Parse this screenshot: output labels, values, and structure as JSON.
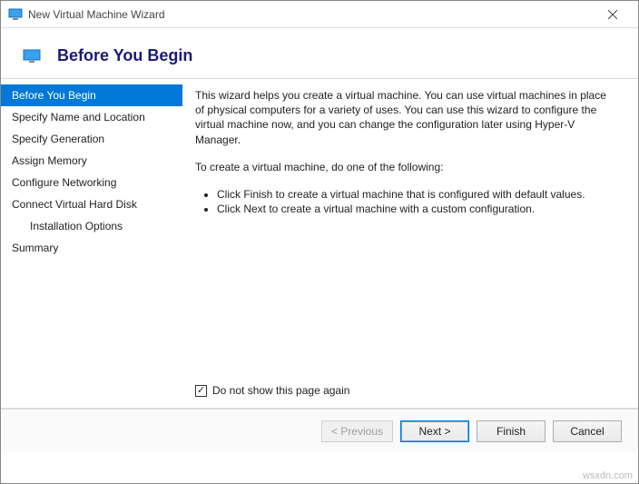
{
  "titlebar": {
    "title": "New Virtual Machine Wizard"
  },
  "header": {
    "title": "Before You Begin"
  },
  "sidebar": {
    "items": [
      {
        "label": "Before You Begin",
        "selected": true,
        "indent": false
      },
      {
        "label": "Specify Name and Location",
        "selected": false,
        "indent": false
      },
      {
        "label": "Specify Generation",
        "selected": false,
        "indent": false
      },
      {
        "label": "Assign Memory",
        "selected": false,
        "indent": false
      },
      {
        "label": "Configure Networking",
        "selected": false,
        "indent": false
      },
      {
        "label": "Connect Virtual Hard Disk",
        "selected": false,
        "indent": false
      },
      {
        "label": "Installation Options",
        "selected": false,
        "indent": true
      },
      {
        "label": "Summary",
        "selected": false,
        "indent": false
      }
    ]
  },
  "content": {
    "intro": "This wizard helps you create a virtual machine. You can use virtual machines in place of physical computers for a variety of uses. You can use this wizard to configure the virtual machine now, and you can change the configuration later using Hyper-V Manager.",
    "instruction": "To create a virtual machine, do one of the following:",
    "bullets": [
      "Click Finish to create a virtual machine that is configured with default values.",
      "Click Next to create a virtual machine with a custom configuration."
    ],
    "checkbox_label": "Do not show this page again",
    "checkbox_checked": true
  },
  "footer": {
    "previous_label": "< Previous",
    "next_label": "Next >",
    "finish_label": "Finish",
    "cancel_label": "Cancel"
  },
  "watermark": "wsxdn.com"
}
